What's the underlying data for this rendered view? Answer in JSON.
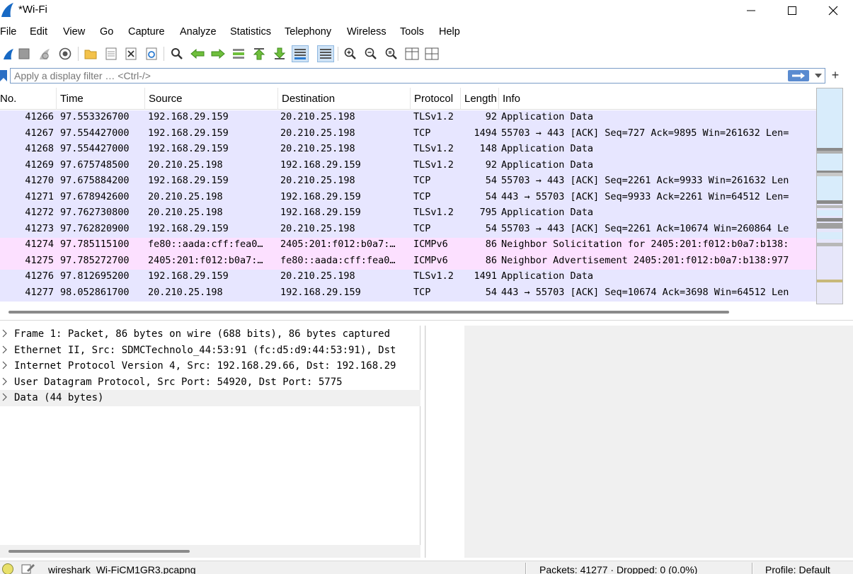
{
  "window": {
    "title": "*Wi-Fi",
    "minimize_icon": "minimize-icon",
    "maximize_icon": "maximize-icon",
    "close_icon": "close-icon"
  },
  "menu": [
    "File",
    "Edit",
    "View",
    "Go",
    "Capture",
    "Analyze",
    "Statistics",
    "Telephony",
    "Wireless",
    "Tools",
    "Help"
  ],
  "toolbar": {
    "icons": [
      "start-capture-icon",
      "stop-capture-icon",
      "restart-capture-icon",
      "capture-options-icon",
      "open-file-icon",
      "save-file-icon",
      "close-file-icon",
      "reload-file-icon",
      "find-packet-icon",
      "go-back-icon",
      "go-forward-icon",
      "go-to-packet-icon",
      "go-first-packet-icon",
      "go-last-packet-icon",
      "auto-scroll-icon",
      "colorize-icon",
      "zoom-in-icon",
      "zoom-out-icon",
      "normal-size-icon",
      "resize-columns-icon"
    ]
  },
  "filter": {
    "placeholder": "Apply a display filter … <Ctrl-/>",
    "value": ""
  },
  "packet_list": {
    "columns": [
      "No.",
      "Time",
      "Source",
      "Destination",
      "Protocol",
      "Length",
      "Info"
    ],
    "rows": [
      {
        "no": "41266",
        "time": "97.553326700",
        "src": "192.168.29.159",
        "dst": "20.210.25.198",
        "proto": "TLSv1.2",
        "len": "92",
        "info": "Application Data",
        "kind": "tcp"
      },
      {
        "no": "41267",
        "time": "97.554427000",
        "src": "192.168.29.159",
        "dst": "20.210.25.198",
        "proto": "TCP",
        "len": "1494",
        "info": "55703 → 443 [ACK] Seq=727 Ack=9895 Win=261632 Len=",
        "kind": "tcp"
      },
      {
        "no": "41268",
        "time": "97.554427000",
        "src": "192.168.29.159",
        "dst": "20.210.25.198",
        "proto": "TLSv1.2",
        "len": "148",
        "info": "Application Data",
        "kind": "tcp"
      },
      {
        "no": "41269",
        "time": "97.675748500",
        "src": "20.210.25.198",
        "dst": "192.168.29.159",
        "proto": "TLSv1.2",
        "len": "92",
        "info": "Application Data",
        "kind": "tcp"
      },
      {
        "no": "41270",
        "time": "97.675884200",
        "src": "192.168.29.159",
        "dst": "20.210.25.198",
        "proto": "TCP",
        "len": "54",
        "info": "55703 → 443 [ACK] Seq=2261 Ack=9933 Win=261632 Len",
        "kind": "tcp"
      },
      {
        "no": "41271",
        "time": "97.678942600",
        "src": "20.210.25.198",
        "dst": "192.168.29.159",
        "proto": "TCP",
        "len": "54",
        "info": "443 → 55703 [ACK] Seq=9933 Ack=2261 Win=64512 Len=",
        "kind": "tcp"
      },
      {
        "no": "41272",
        "time": "97.762730800",
        "src": "20.210.25.198",
        "dst": "192.168.29.159",
        "proto": "TLSv1.2",
        "len": "795",
        "info": "Application Data",
        "kind": "tcp"
      },
      {
        "no": "41273",
        "time": "97.762820900",
        "src": "192.168.29.159",
        "dst": "20.210.25.198",
        "proto": "TCP",
        "len": "54",
        "info": "55703 → 443 [ACK] Seq=2261 Ack=10674 Win=260864 Le",
        "kind": "tcp"
      },
      {
        "no": "41274",
        "time": "97.785115100",
        "src": "fe80::aada:cff:fea0…",
        "dst": "2405:201:f012:b0a7:…",
        "proto": "ICMPv6",
        "len": "86",
        "info": "Neighbor Solicitation for 2405:201:f012:b0a7:b138:",
        "kind": "icmp"
      },
      {
        "no": "41275",
        "time": "97.785272700",
        "src": "2405:201:f012:b0a7:…",
        "dst": "fe80::aada:cff:fea0…",
        "proto": "ICMPv6",
        "len": "86",
        "info": "Neighbor Advertisement 2405:201:f012:b0a7:b138:977",
        "kind": "icmp"
      },
      {
        "no": "41276",
        "time": "97.812695200",
        "src": "192.168.29.159",
        "dst": "20.210.25.198",
        "proto": "TLSv1.2",
        "len": "1491",
        "info": "Application Data",
        "kind": "tcp"
      },
      {
        "no": "41277",
        "time": "98.052861700",
        "src": "20.210.25.198",
        "dst": "192.168.29.159",
        "proto": "TCP",
        "len": "54",
        "info": "443 → 55703 [ACK] Seq=10674 Ack=3698 Win=64512 Len",
        "kind": "tcp"
      }
    ]
  },
  "details": [
    "Frame 1: Packet, 86 bytes on wire (688 bits), 86 bytes captured",
    "Ethernet II, Src: SDMCTechnolo_44:53:91 (fc:d5:d9:44:53:91), Dst",
    "Internet Protocol Version 4, Src: 192.168.29.66, Dst: 192.168.29",
    "User Datagram Protocol, Src Port: 54920, Dst Port: 5775",
    "Data (44 bytes)"
  ],
  "statusbar": {
    "file": "wireshark_Wi-FiCM1GR3.pcapng",
    "packets": "Packets: 41277 · Dropped: 0 (0.0%)",
    "profile": "Profile: Default"
  },
  "colors": {
    "tcp_row": "#e7e6ff",
    "icmp_row": "#fce0ff",
    "accent": "#5a8bd0"
  }
}
